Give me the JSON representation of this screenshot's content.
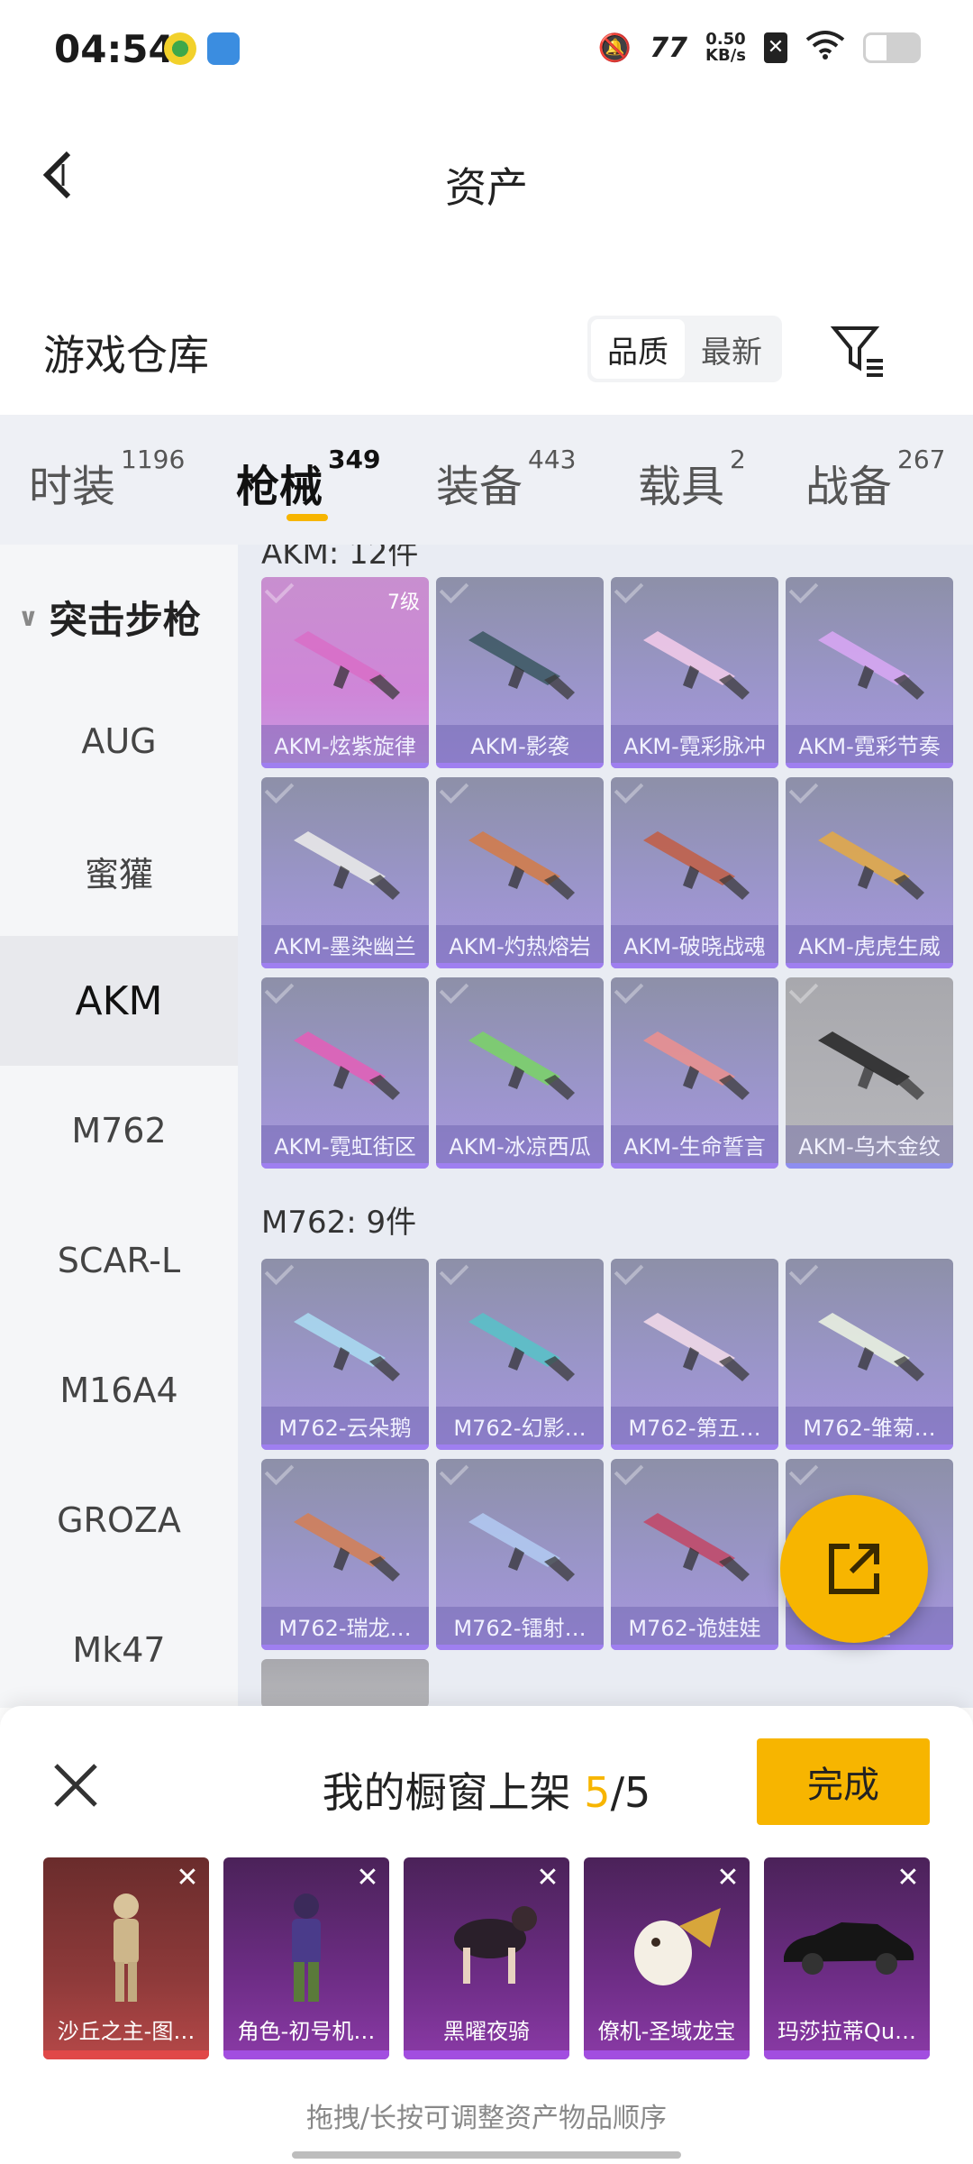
{
  "status": {
    "time": "04:54",
    "net_value": "0.50",
    "net_unit": "KB/s"
  },
  "header": {
    "title": "资产"
  },
  "section": {
    "title": "游戏仓库",
    "sort_options": [
      "品质",
      "最新"
    ]
  },
  "tabs": [
    {
      "label": "时装",
      "count": "1196"
    },
    {
      "label": "枪械",
      "count": "349"
    },
    {
      "label": "装备",
      "count": "443"
    },
    {
      "label": "载具",
      "count": "2"
    },
    {
      "label": "战备",
      "count": "267"
    }
  ],
  "sidebar": {
    "category": "突击步枪",
    "items": [
      "AUG",
      "蜜獾",
      "AKM",
      "M762",
      "SCAR-L",
      "M16A4",
      "GROZA",
      "Mk47"
    ]
  },
  "akm": {
    "partial_title": "AKM: 12件",
    "level_badge": "7级",
    "items": [
      "AKM-炫紫旋律",
      "AKM-影袭",
      "AKM-霓彩脉冲",
      "AKM-霓彩节奏",
      "AKM-墨染幽兰",
      "AKM-灼热熔岩",
      "AKM-破晓战魂",
      "AKM-虎虎生威",
      "AKM-霓虹街区",
      "AKM-冰凉西瓜",
      "AKM-生命誓言",
      "AKM-乌木金纹"
    ]
  },
  "m762": {
    "title": "M762: 9件",
    "items": [
      "M762-云朵鹅",
      "M762-幻影…",
      "M762-第五…",
      "M762-雏菊…",
      "M762-瑞龙…",
      "M762-镭射…",
      "M762-诡娃娃",
      "…丑"
    ]
  },
  "bottom": {
    "title_prefix": "我的橱窗上架",
    "count": "5",
    "total": "/5",
    "done": "完成",
    "items": [
      "沙丘之主-图…",
      "角色-初号机…",
      "黑曜夜骑",
      "僚机-圣域龙宝",
      "玛莎拉蒂Qu…"
    ],
    "hint": "拖拽/长按可调整资产物品顺序"
  }
}
